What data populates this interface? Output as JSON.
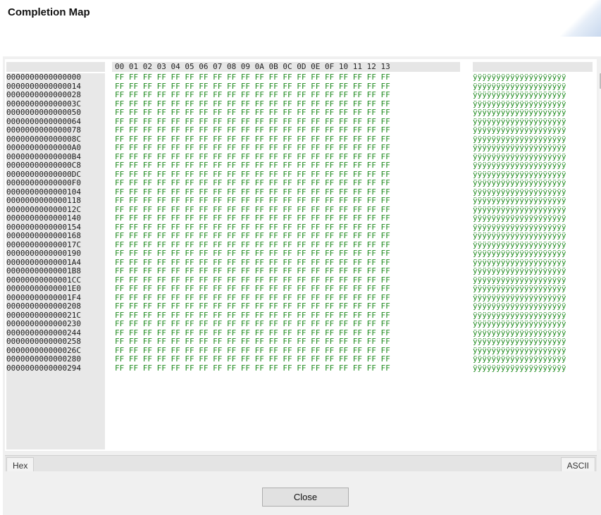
{
  "window": {
    "title": "Completion Map"
  },
  "hex_view": {
    "column_header": "00 01 02 03 04 05 06 07 08 09 0A 0B 0C 0D 0E 0F 10 11 12 13",
    "addresses": [
      "0000000000000000",
      "0000000000000014",
      "0000000000000028",
      "000000000000003C",
      "0000000000000050",
      "0000000000000064",
      "0000000000000078",
      "000000000000008C",
      "00000000000000A0",
      "00000000000000B4",
      "00000000000000C8",
      "00000000000000DC",
      "00000000000000F0",
      "0000000000000104",
      "0000000000000118",
      "000000000000012C",
      "0000000000000140",
      "0000000000000154",
      "0000000000000168",
      "000000000000017C",
      "0000000000000190",
      "00000000000001A4",
      "00000000000001B8",
      "00000000000001CC",
      "00000000000001E0",
      "00000000000001F4",
      "0000000000000208",
      "000000000000021C",
      "0000000000000230",
      "0000000000000244",
      "0000000000000258",
      "000000000000026C",
      "0000000000000280",
      "0000000000000294"
    ],
    "hex_row": "FF FF FF FF FF FF FF FF FF FF FF FF FF FF FF FF FF FF FF FF",
    "ascii_row": "ÿÿÿÿÿÿÿÿÿÿÿÿÿÿÿÿÿÿÿÿ",
    "colors": {
      "data": "#1e8a1e",
      "address_bg": "#e8e8e8"
    }
  },
  "tabs": {
    "hex": "Hex",
    "ascii": "ASCII"
  },
  "buttons": {
    "close": "Close"
  }
}
